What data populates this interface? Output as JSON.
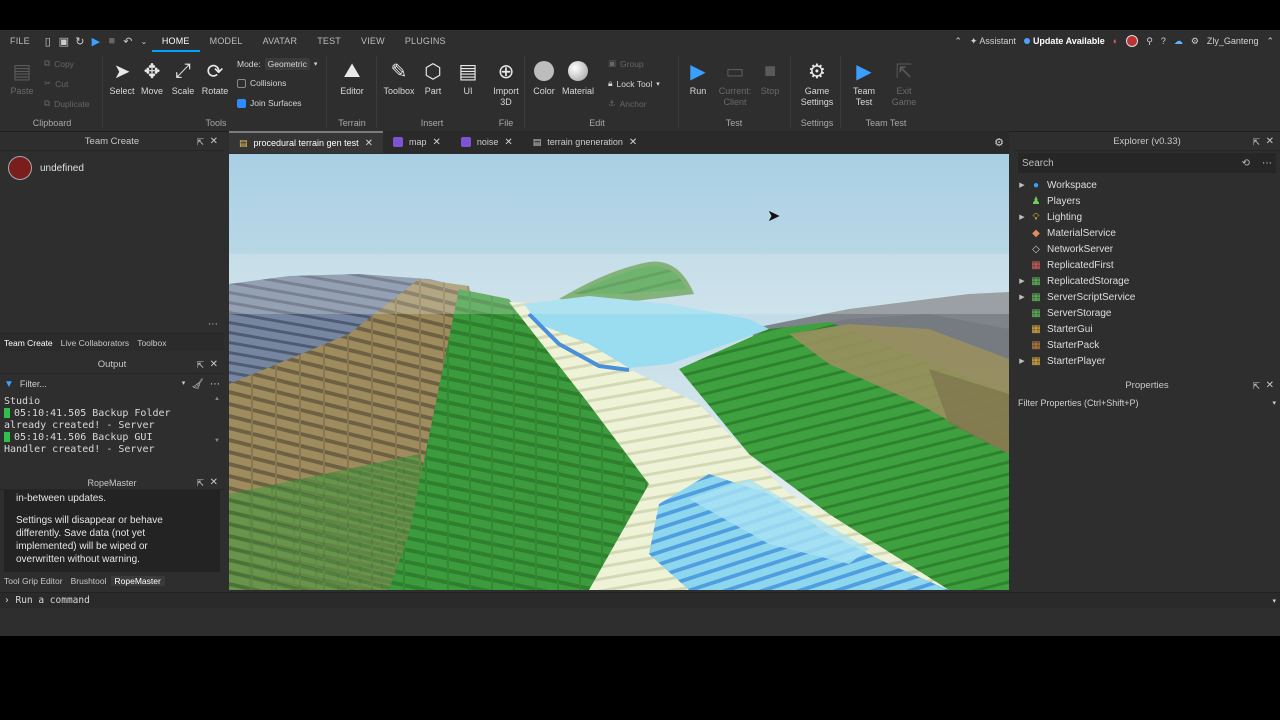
{
  "menubar": {
    "tabs": [
      "FILE",
      "HOME",
      "MODEL",
      "AVATAR",
      "TEST",
      "VIEW",
      "PLUGINS"
    ],
    "active": "HOME",
    "assistant": "Assistant",
    "update": "Update Available",
    "username": "Zly_Ganteng"
  },
  "ribbon": {
    "clipboard": {
      "paste": "Paste",
      "copy": "Copy",
      "cut": "Cut",
      "duplicate": "Duplicate",
      "group": "Clipboard"
    },
    "tools": {
      "select": "Select",
      "move": "Move",
      "scale": "Scale",
      "rotate": "Rotate",
      "mode_label": "Mode:",
      "mode_value": "Geometric",
      "collisions": "Collisions",
      "join_surfaces": "Join Surfaces",
      "group": "Tools"
    },
    "terrain": {
      "editor": "Editor",
      "group": "Terrain"
    },
    "insert": {
      "toolbox": "Toolbox",
      "part": "Part",
      "ui": "UI",
      "group": "Insert"
    },
    "file": {
      "import3d_1": "Import",
      "import3d_2": "3D",
      "group": "File"
    },
    "edit": {
      "color": "Color",
      "material": "Material",
      "group_btn": "Group",
      "lock_tool": "Lock Tool",
      "anchor": "Anchor",
      "group": "Edit"
    },
    "test": {
      "run": "Run",
      "current_1": "Current:",
      "current_2": "Client",
      "stop": "Stop",
      "group": "Test"
    },
    "settings": {
      "game_1": "Game",
      "game_2": "Settings",
      "group": "Settings"
    },
    "teamtest": {
      "team_1": "Team",
      "team_2": "Test",
      "exit_1": "Exit",
      "exit_2": "Game",
      "group": "Team Test"
    }
  },
  "teamcreate": {
    "title": "Team Create",
    "user": "undefined",
    "tabs": [
      "Team Create",
      "Live Collaborators",
      "Toolbox"
    ]
  },
  "output": {
    "title": "Output",
    "filter_placeholder": "Filter...",
    "line0": "Studio",
    "line1a": "05:10:41.505  Backup Folder",
    "line1b": "already created!  -  Server",
    "line2a": "05:10:41.506  Backup GUI",
    "line2b": "Handler created!  -  Server"
  },
  "ropemaster": {
    "title": "RopeMaster",
    "text1": "in-between updates.",
    "text2a": "Settings will disappear or behave",
    "text2b": "differently. Save data (not yet",
    "text2c": "implemented) will be wiped or",
    "text2d": "overwritten without warning.",
    "tabs": [
      "Tool Grip Editor",
      "Brushtool",
      "RopeMaster"
    ]
  },
  "doctabs": [
    {
      "label": "procedural terrain gen test",
      "active": true
    },
    {
      "label": "map",
      "active": false
    },
    {
      "label": "noise",
      "active": false
    },
    {
      "label": "terrain gneneration",
      "active": false
    }
  ],
  "explorer": {
    "title": "Explorer (v0.33)",
    "search_placeholder": "Search",
    "items": [
      {
        "label": "Workspace",
        "expandable": true,
        "icon": "globe-icon",
        "color": "#3aa0ff"
      },
      {
        "label": "Players",
        "expandable": false,
        "icon": "players-icon",
        "color": "#6fcf5f"
      },
      {
        "label": "Lighting",
        "expandable": true,
        "icon": "bulb-icon",
        "color": "#f2d33b"
      },
      {
        "label": "MaterialService",
        "expandable": false,
        "icon": "material-icon",
        "color": "#e08f5a"
      },
      {
        "label": "NetworkServer",
        "expandable": false,
        "icon": "network-icon",
        "color": "#cfcfcf"
      },
      {
        "label": "ReplicatedFirst",
        "expandable": false,
        "icon": "replicated-first-icon",
        "color": "#d46060"
      },
      {
        "label": "ReplicatedStorage",
        "expandable": true,
        "icon": "replicated-storage-icon",
        "color": "#5fbf5f"
      },
      {
        "label": "ServerScriptService",
        "expandable": true,
        "icon": "server-script-icon",
        "color": "#5fbf5f"
      },
      {
        "label": "ServerStorage",
        "expandable": false,
        "icon": "server-storage-icon",
        "color": "#5fbf5f"
      },
      {
        "label": "StarterGui",
        "expandable": false,
        "icon": "starter-gui-icon",
        "color": "#e0b040"
      },
      {
        "label": "StarterPack",
        "expandable": false,
        "icon": "starter-pack-icon",
        "color": "#c08040"
      },
      {
        "label": "StarterPlayer",
        "expandable": true,
        "icon": "starter-player-icon",
        "color": "#e0b040"
      }
    ]
  },
  "properties": {
    "title": "Properties",
    "filter_placeholder": "Filter Properties (Ctrl+Shift+P)"
  },
  "commandbar": {
    "placeholder": "Run a command"
  },
  "colors": {
    "accent": "#00a2ff",
    "grass": "#3e9b3e",
    "sand": "#a08a5a",
    "water": "#8fd8ee",
    "slate": "#6e7f96"
  }
}
